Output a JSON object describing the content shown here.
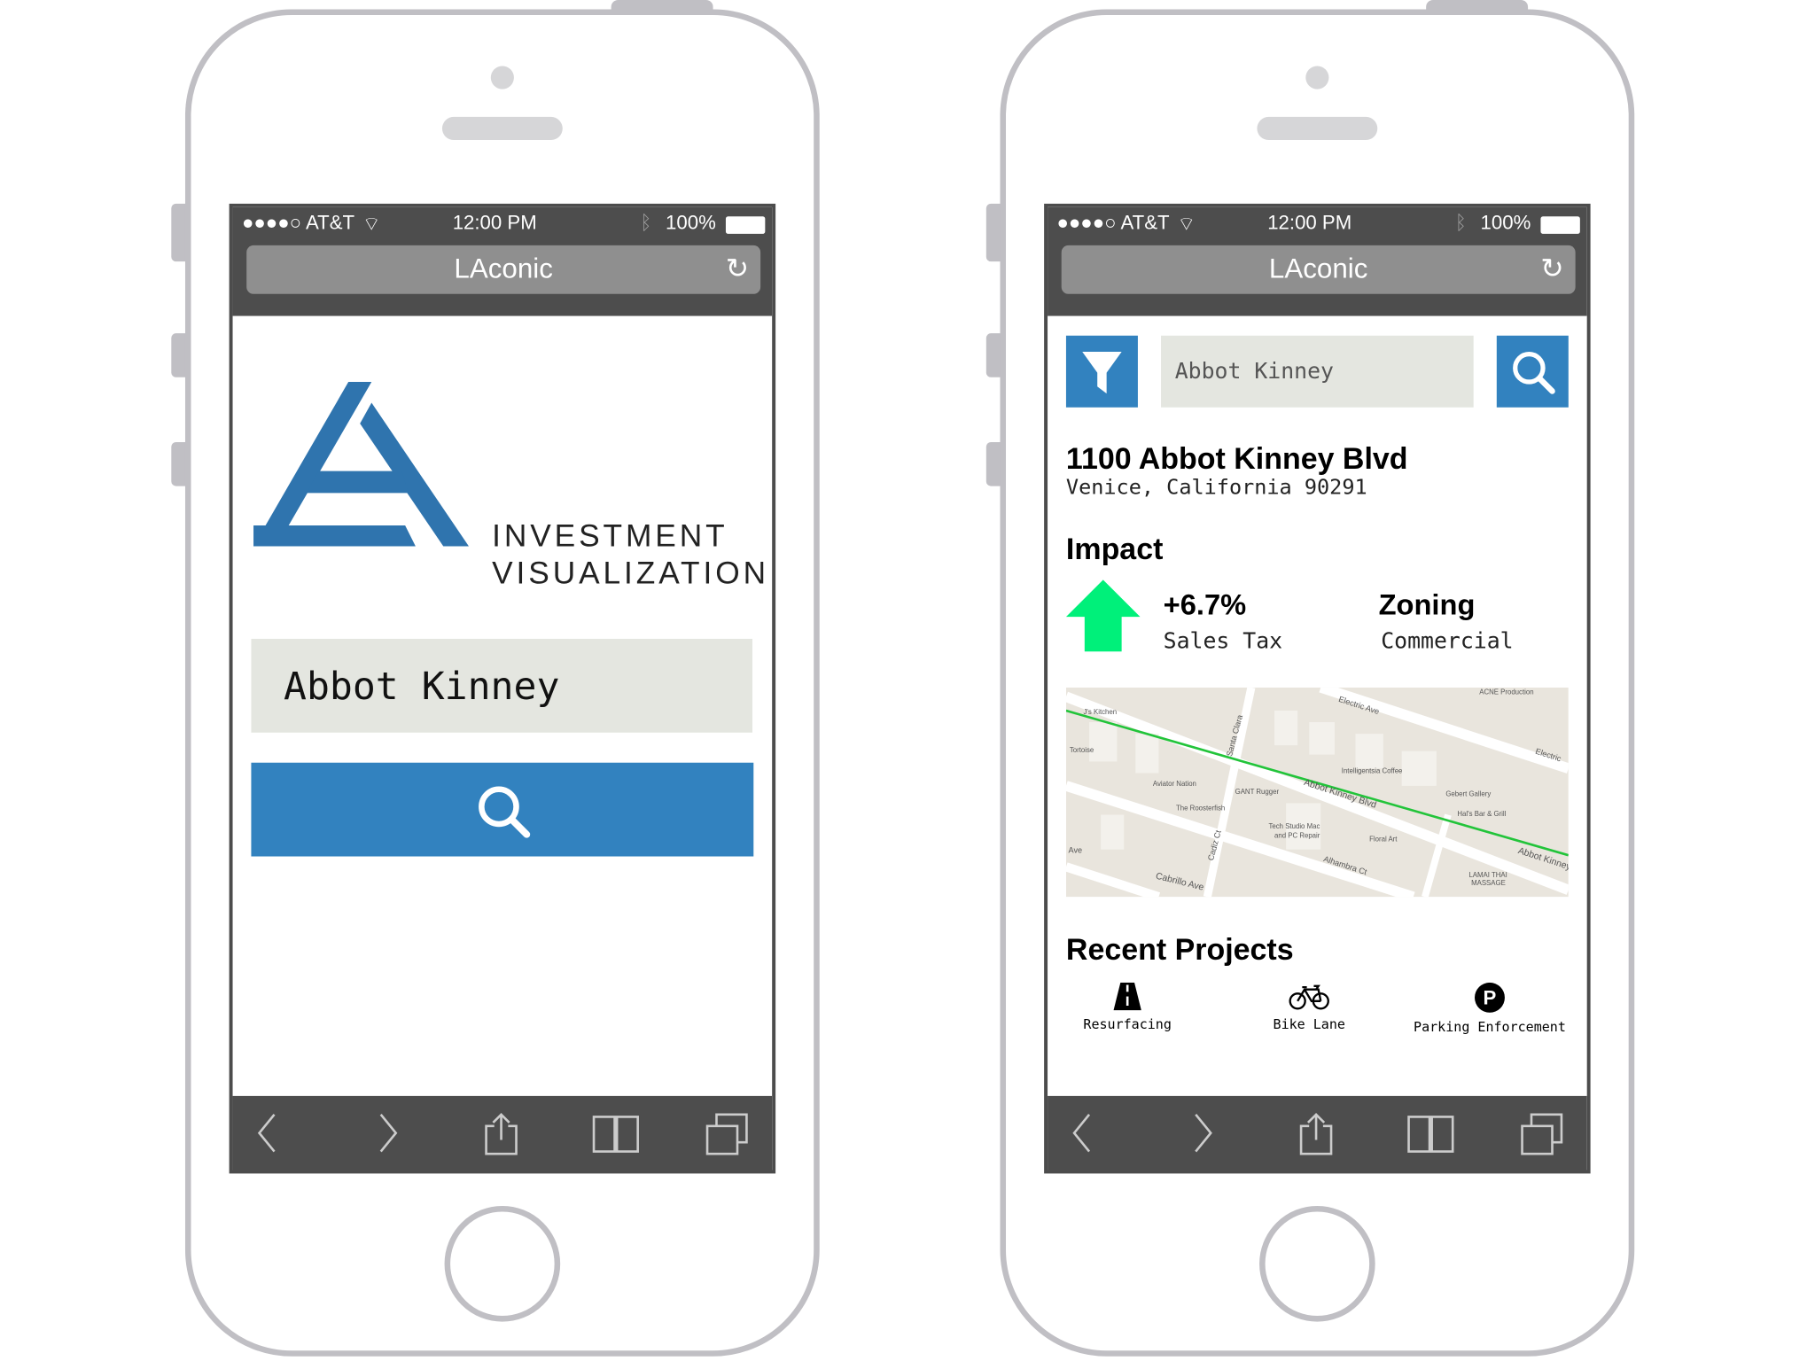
{
  "status_bar": {
    "carrier": "●●●●○ AT&T",
    "time": "12:00 PM",
    "battery": "100%"
  },
  "browser": {
    "url_title": "LAconic"
  },
  "home_screen": {
    "logo_line1": "INVESTMENT",
    "logo_line2": "VISUALIZATION",
    "search_value": "Abbot Kinney",
    "search_button_icon": "search-icon"
  },
  "result_screen": {
    "search_value": "Abbot Kinney",
    "address": "1100 Abbot Kinney Blvd",
    "city": "Venice, California 90291",
    "impact_title": "Impact",
    "impact_value": "+6.7%",
    "impact_label": "Sales Tax",
    "impact_direction": "up",
    "zoning_title": "Zoning",
    "zoning_value": "Commercial",
    "colors": {
      "accent": "#3282bf",
      "up_arrow": "#00f07a",
      "route": "#22c43a"
    },
    "map_labels": [
      "Electric Ave",
      "ACNE Production",
      "J's Kitchen",
      "Tortoise",
      "Santa Clara",
      "Intelligentsia Coffee",
      "Electric",
      "Aviator Nation",
      "GANT Rugger",
      "Abbot Kinney Blvd",
      "Gebert Gallery",
      "The Roosterfish",
      "Hal's Bar & Grill",
      "Tech Studio Mac",
      "and PC Repair",
      "Floral Art",
      "Cadiz Ct",
      "Abbot Kinney",
      "Alhambra Ct",
      "Ave",
      "Cabrillo Ave",
      "LAMAI THAI",
      "MASSAGE"
    ],
    "recent_title": "Recent Projects",
    "projects": [
      {
        "label": "Resurfacing",
        "icon": "road-icon"
      },
      {
        "label": "Bike Lane",
        "icon": "bicycle-icon"
      },
      {
        "label": "Parking Enforcement",
        "icon": "parking-icon"
      }
    ]
  }
}
